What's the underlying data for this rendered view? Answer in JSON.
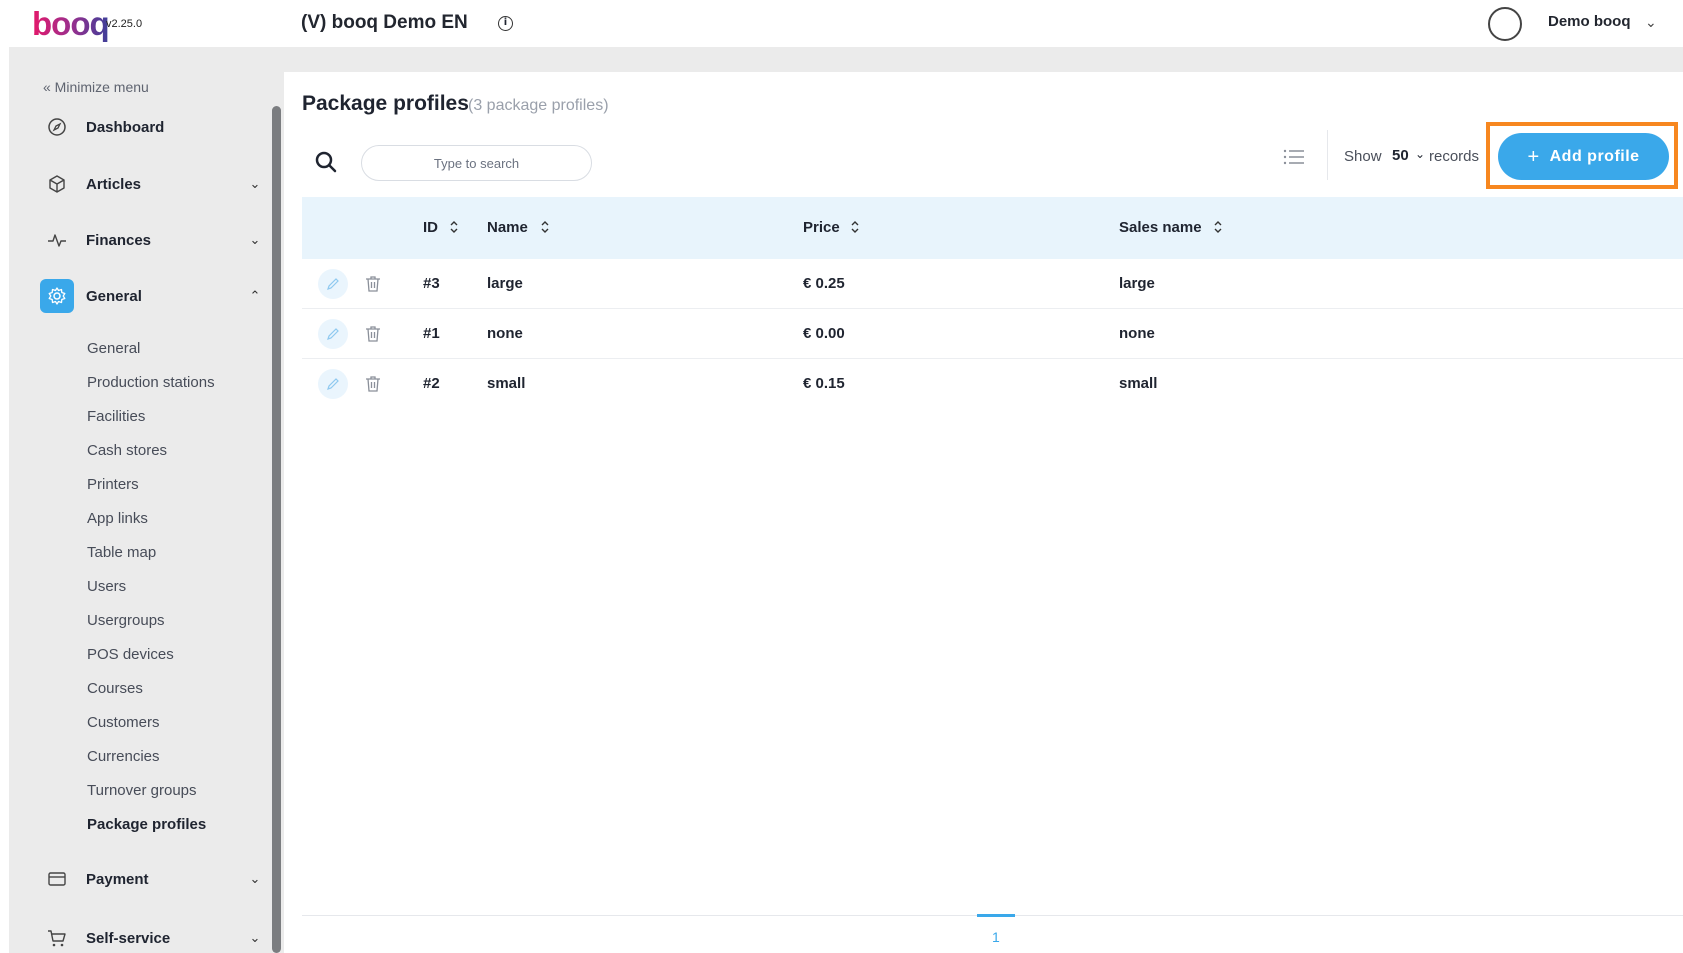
{
  "app": {
    "logo_text": "booq",
    "version": "v2.25.0",
    "company": "(V) booq Demo EN",
    "user_name": "Demo booq"
  },
  "sidebar": {
    "minimize_label": "« Minimize menu",
    "nav": [
      {
        "label": "Dashboard",
        "icon": "compass-icon"
      },
      {
        "label": "Articles",
        "icon": "box-icon"
      },
      {
        "label": "Finances",
        "icon": "pulse-icon"
      },
      {
        "label": "General",
        "icon": "gear-icon"
      },
      {
        "label": "Payment",
        "icon": "card-icon"
      },
      {
        "label": "Self-service",
        "icon": "cart-icon"
      }
    ],
    "general_sub": [
      "General",
      "Production stations",
      "Facilities",
      "Cash stores",
      "Printers",
      "App links",
      "Table map",
      "Users",
      "Usergroups",
      "POS devices",
      "Courses",
      "Customers",
      "Currencies",
      "Turnover groups",
      "Package profiles"
    ],
    "active_sub": "Package profiles"
  },
  "page": {
    "title": "Package profiles",
    "count": "(3 package profiles)",
    "search_placeholder": "Type to search",
    "show_label": "Show",
    "show_value": "50",
    "records_label": "records",
    "add_button": "Add profile"
  },
  "table": {
    "columns": [
      "ID",
      "Name",
      "Price",
      "Sales name"
    ],
    "rows": [
      {
        "id": "#3",
        "name": "large",
        "price": "€ 0.25",
        "sales_name": "large"
      },
      {
        "id": "#1",
        "name": "none",
        "price": "€ 0.00",
        "sales_name": "none"
      },
      {
        "id": "#2",
        "name": "small",
        "price": "€ 0.15",
        "sales_name": "small"
      }
    ]
  },
  "pagination": {
    "current": "1"
  },
  "colors": {
    "accent": "#3aa8ea",
    "highlight": "#f7871f",
    "header_bg": "#e8f4fc"
  }
}
